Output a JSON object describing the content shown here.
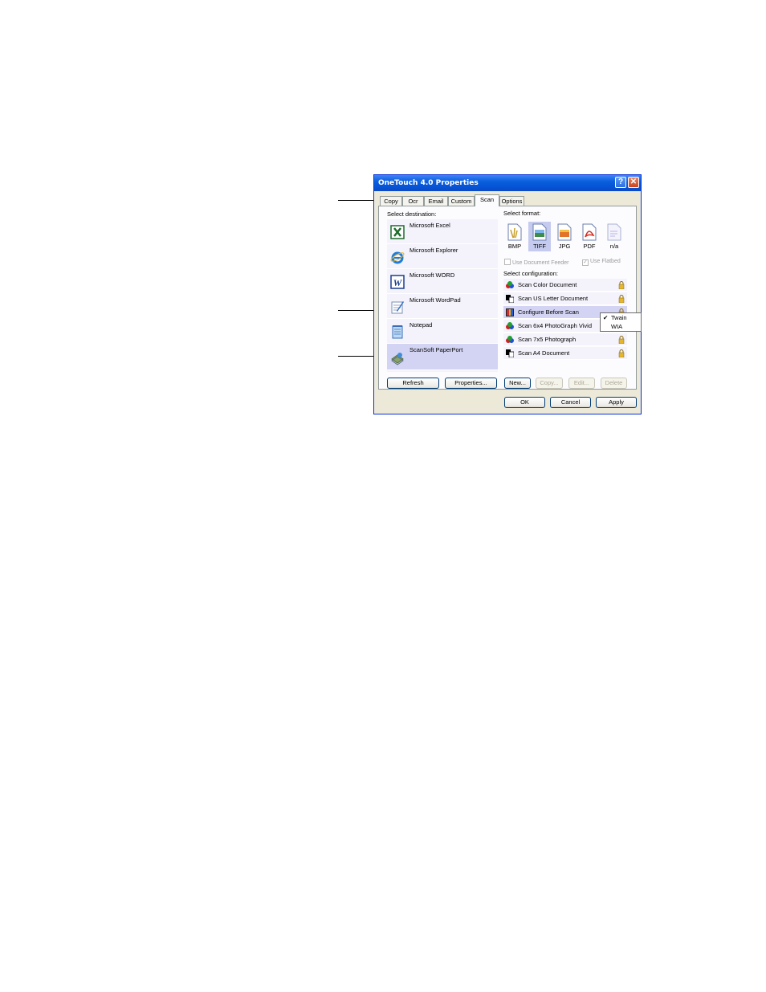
{
  "window": {
    "title": "OneTouch 4.0 Properties",
    "help_label": "?",
    "close_label": "✕"
  },
  "tabs": [
    "Copy",
    "Ocr",
    "Email",
    "Custom",
    "Scan",
    "Options"
  ],
  "active_tab": "Scan",
  "destination": {
    "label": "Select destination:",
    "items": [
      {
        "label": "Microsoft Excel",
        "icon": "excel-icon"
      },
      {
        "label": "Microsoft Explorer",
        "icon": "explorer-icon"
      },
      {
        "label": "Microsoft WORD",
        "icon": "word-icon"
      },
      {
        "label": "Microsoft WordPad",
        "icon": "wordpad-icon"
      },
      {
        "label": "Notepad",
        "icon": "notepad-icon"
      },
      {
        "label": "ScanSoft PaperPort",
        "icon": "paperport-icon"
      }
    ],
    "selected": "ScanSoft PaperPort"
  },
  "format": {
    "label": "Select format:",
    "items": [
      "BMP",
      "TIFF",
      "JPG",
      "PDF",
      "n/a"
    ],
    "selected": "TIFF"
  },
  "checkboxes": {
    "document_feeder": {
      "label": "Use Document Feeder",
      "checked": false
    },
    "flatbed": {
      "label": "Use Flatbed",
      "checked": true
    }
  },
  "configuration": {
    "label": "Select configuration:",
    "items": [
      "Scan Color Document",
      "Scan US Letter Document",
      "Configure Before Scan",
      "Scan 6x4 PhotoGraph Vivid",
      "Scan 7x5 Photograph",
      "Scan A4 Document"
    ],
    "selected": "Configure Before Scan"
  },
  "popup": {
    "items": [
      "Twain",
      "WIA"
    ],
    "checked": "Twain"
  },
  "buttons": {
    "refresh": "Refresh",
    "properties": "Properties...",
    "new": "New...",
    "copy": "Copy...",
    "edit": "Edit...",
    "delete": "Delete",
    "ok": "OK",
    "cancel": "Cancel",
    "apply": "Apply"
  },
  "colors": {
    "titlebar": "#0A5FDD",
    "selection": "#D3D4F3",
    "panel": "#ECE9D8"
  }
}
